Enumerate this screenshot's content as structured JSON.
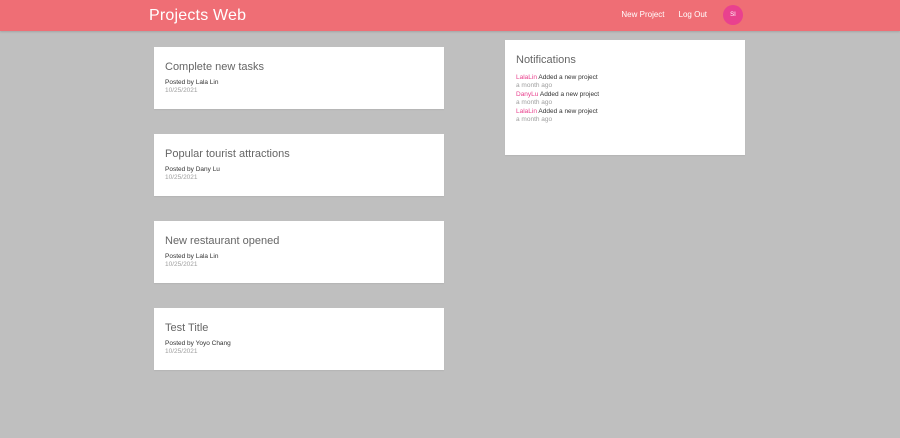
{
  "navbar": {
    "brand": "Projects Web",
    "links": [
      "New Project",
      "Log Out"
    ],
    "avatar_initials": "SI",
    "background_color": "#ef6e75",
    "avatar_color": "#e9418e"
  },
  "projects": [
    {
      "title": "Complete new tasks",
      "posted_by": "Posted by Lala Lin",
      "date": "10/25/2021"
    },
    {
      "title": "Popular tourist attractions",
      "posted_by": "Posted by Dany Lu",
      "date": "10/25/2021"
    },
    {
      "title": "New restaurant opened",
      "posted_by": "Posted by Lala Lin",
      "date": "10/25/2021"
    },
    {
      "title": "Test Title",
      "posted_by": "Posted by Yoyo Chang",
      "date": "10/25/2021"
    }
  ],
  "notifications": {
    "title": "Notifications",
    "items": [
      {
        "user": "LalaLin",
        "action": " Added a new project",
        "time": "a month ago"
      },
      {
        "user": "DanyLu",
        "action": " Added a new project",
        "time": "a month ago"
      },
      {
        "user": "LalaLin",
        "action": " Added a new project",
        "time": "a month ago"
      }
    ]
  }
}
